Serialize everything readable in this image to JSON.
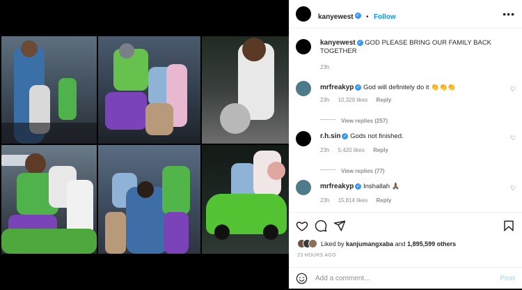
{
  "header": {
    "username": "kanyewest",
    "follow_label": "Follow",
    "more_icon": "more-horizontal-icon"
  },
  "caption": {
    "username": "kanyewest",
    "text": "GOD PLEASE BRING OUR FAMILY BACK TOGETHER",
    "time": "23h"
  },
  "comments": [
    {
      "username": "mrfreakyp",
      "text": "God will definitely do it 👏👏👏",
      "time": "23h",
      "likes": "10,329 likes",
      "reply_label": "Reply",
      "view_replies": "View replies (257)"
    },
    {
      "username": "r.h.sin",
      "text": "Gods not finished.",
      "time": "23h",
      "likes": "5,420 likes",
      "reply_label": "Reply",
      "view_replies": "View replies (77)"
    },
    {
      "username": "mrfreakyp",
      "text": "Inshallah 🙏🏾",
      "time": "23h",
      "likes": "15,814 likes",
      "reply_label": "Reply"
    }
  ],
  "footer": {
    "liked_by_prefix": "Liked by ",
    "liked_by_user": "kanjumangxaba",
    "liked_by_and": " and ",
    "liked_by_others": "1,895,599 others",
    "timestamp": "23 HOURS AGO",
    "comment_placeholder": "Add a comment...",
    "post_label": "Post"
  },
  "colors": {
    "accent": "#0095f6",
    "verified": "#3897f0",
    "muted": "#8e8e8e"
  }
}
